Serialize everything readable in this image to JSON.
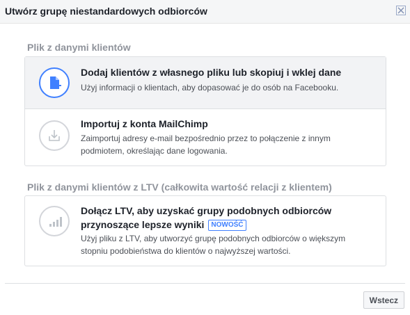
{
  "dialog": {
    "title": "Utwórz grupę niestandardowych odbiorców",
    "close_icon": "close-icon"
  },
  "sections": [
    {
      "title": "Plik z danymi klientów",
      "options": [
        {
          "icon": "file-add-icon",
          "title": "Dodaj klientów z własnego pliku lub skopiuj i wklej dane",
          "description": "Użyj informacji o klientach, aby dopasować je do osób na Facebooku.",
          "selected": true
        },
        {
          "icon": "import-icon",
          "title": "Importuj z konta MailChimp",
          "description": "Zaimportuj adresy e-mail bezpośrednio przez to połączenie z innym podmiotem, określając dane logowania.",
          "selected": false
        }
      ]
    },
    {
      "title": "Plik z danymi klientów z LTV (całkowita wartość relacji z klientem)",
      "options": [
        {
          "icon": "bar-chart-icon",
          "title": "Dołącz LTV, aby uzyskać grupy podobnych odbiorców przynoszące lepsze wyniki",
          "badge": "NOWOŚĆ",
          "description": "Użyj pliku z LTV, aby utworzyć grupę podobnych odbiorców o większym stopniu podobieństwa do klientów o najwyższej wartości.",
          "selected": false
        }
      ]
    }
  ],
  "footer": {
    "back_label": "Wstecz"
  },
  "colors": {
    "accent": "#4080ff",
    "muted": "#90949c",
    "border": "#dddfe2"
  }
}
